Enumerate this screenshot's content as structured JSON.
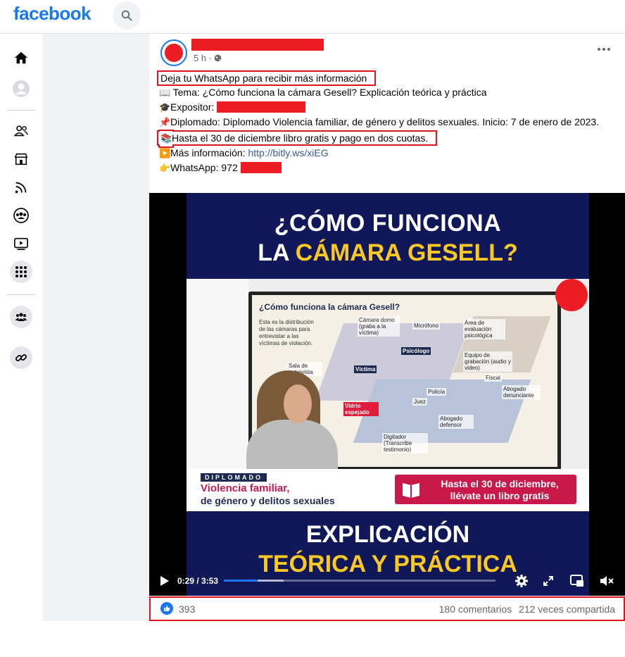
{
  "header": {
    "logo_text": "facebook",
    "brand_color": "#1877f2",
    "search_icon": "search-icon"
  },
  "left_rail": {
    "items": [
      {
        "name": "home-icon"
      },
      {
        "name": "profile-avatar-icon"
      },
      {
        "name": "friends-icon"
      },
      {
        "name": "marketplace-icon"
      },
      {
        "name": "feeds-icon"
      },
      {
        "name": "groups-icon"
      },
      {
        "name": "watch-icon"
      },
      {
        "name": "menu-grid-icon"
      },
      {
        "name": "community-icon"
      },
      {
        "name": "link-icon"
      }
    ]
  },
  "post": {
    "time": "5 h ·",
    "lines": {
      "whatsapp_cta": "Deja tu WhatsApp para recibir más información",
      "tema_emoji": "📖",
      "tema": " Tema: ¿Cómo funciona la cámara Gesell? Explicación teórica y práctica",
      "expositor_emoji": "🎓",
      "expositor": "Expositor: ",
      "diplomado_emoji": "📌",
      "diplomado": "Diplomado: Diplomado Violencia familiar, de género y delitos sexuales. Inicio: 7 de enero de 2023.",
      "libro_emoji": "📚",
      "libro": "Hasta el 30 de diciembre libro gratis y pago en dos cuotas.",
      "mas_info_emoji": "▶️",
      "mas_info": "Más información: ",
      "mas_info_link": "http://bitly.ws/xiEG",
      "whatsapp_emoji": "👉",
      "whatsapp": "WhatsApp: 972 "
    },
    "highlight_color": "#e0141e",
    "redaction_color": "#ee1c25"
  },
  "video": {
    "title_line1": "¿CÓMO FUNCIONA",
    "title_line2_white": "LA ",
    "title_line2_yellow": "CÁMARA GESELL?",
    "screen": {
      "title": "¿Cómo funciona la cámara Gesell?",
      "intro": "Esta es la distribución de las cámaras para entrevistar a las víctimas de violación.",
      "labels": [
        "Cámara domo (graba a la víctima)",
        "Micrófono",
        "Área de evaluación psicológica",
        "Psicólogo",
        "Equipo de grabación (audio y video)",
        "Sala de entrevista",
        "Víctima",
        "Fiscal",
        "Abogado denunciante",
        "Policía",
        "Juez",
        "Vidrio espejado",
        "Abogado defensor",
        "Digitador (Transcribe testimonio)"
      ]
    },
    "banner": {
      "tag": "DIPLOMADO",
      "line1": "Violencia familiar,",
      "line2": "de género y delitos sexuales",
      "promo_line1": "Hasta el 30 de diciembre,",
      "promo_line2": "llévate un libro gratis"
    },
    "bottom_line1": "EXPLICACIÓN",
    "bottom_line2": "TEÓRICA Y PRÁCTICA",
    "controls": {
      "time": "0:29 / 3:53",
      "progress": 0.124,
      "buffered": 0.22
    }
  },
  "footer": {
    "likes": "393",
    "comments": "180 comentarios",
    "shares": "212 veces compartida"
  }
}
